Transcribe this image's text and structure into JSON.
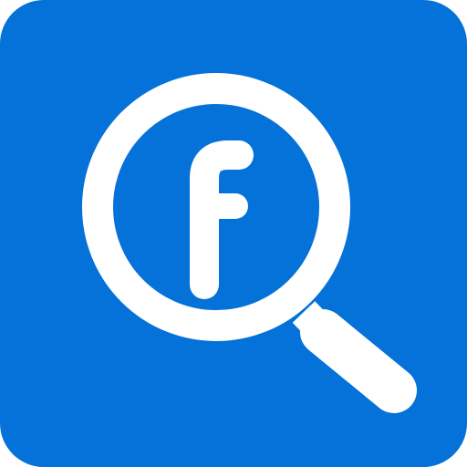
{
  "icon": {
    "name": "facebook-search-icon",
    "glyph": "f",
    "colors": {
      "background": "#0472D8",
      "foreground": "#FFFFFF"
    }
  }
}
